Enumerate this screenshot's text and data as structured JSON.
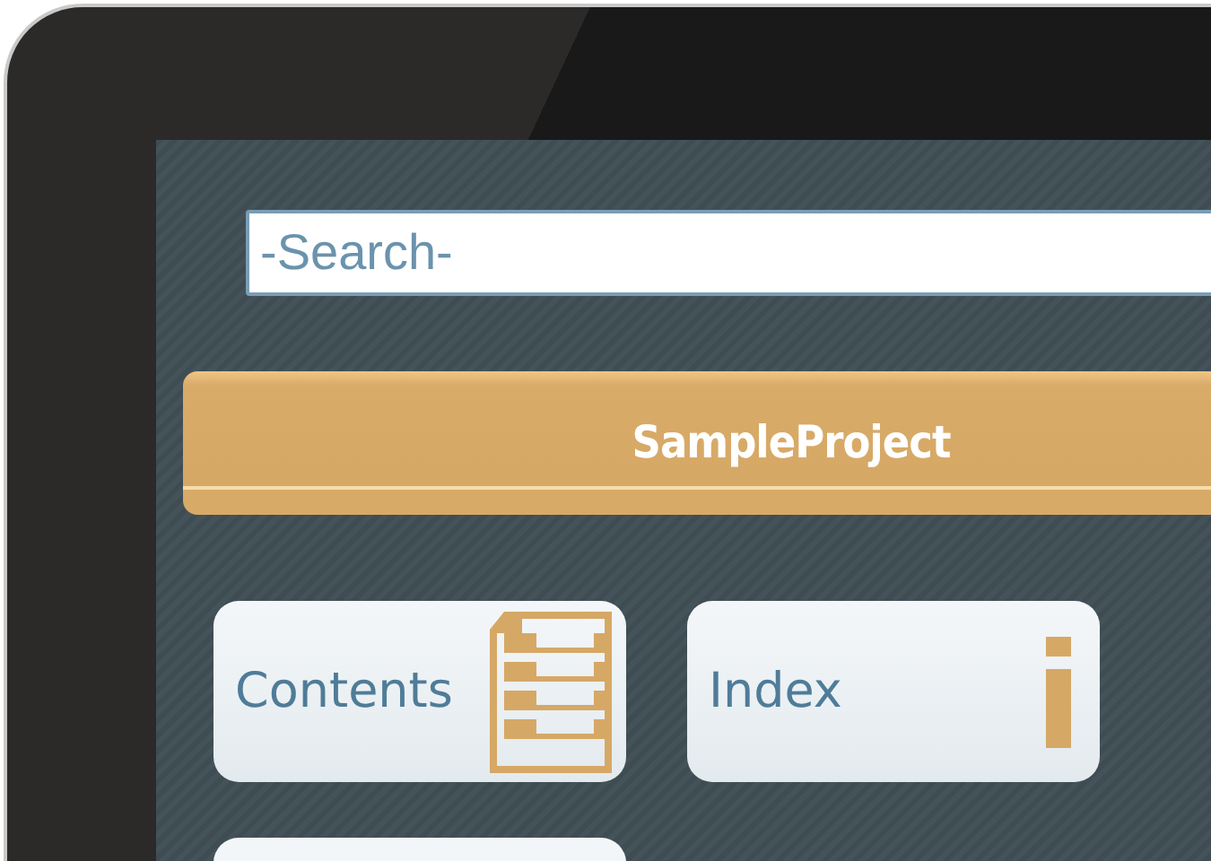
{
  "search": {
    "placeholder": "-Search-"
  },
  "header": {
    "title": "SampleProject"
  },
  "tiles": [
    {
      "kind": "contents",
      "label": "Contents"
    },
    {
      "kind": "index",
      "label": "Index"
    },
    {
      "kind": "blank"
    }
  ]
}
